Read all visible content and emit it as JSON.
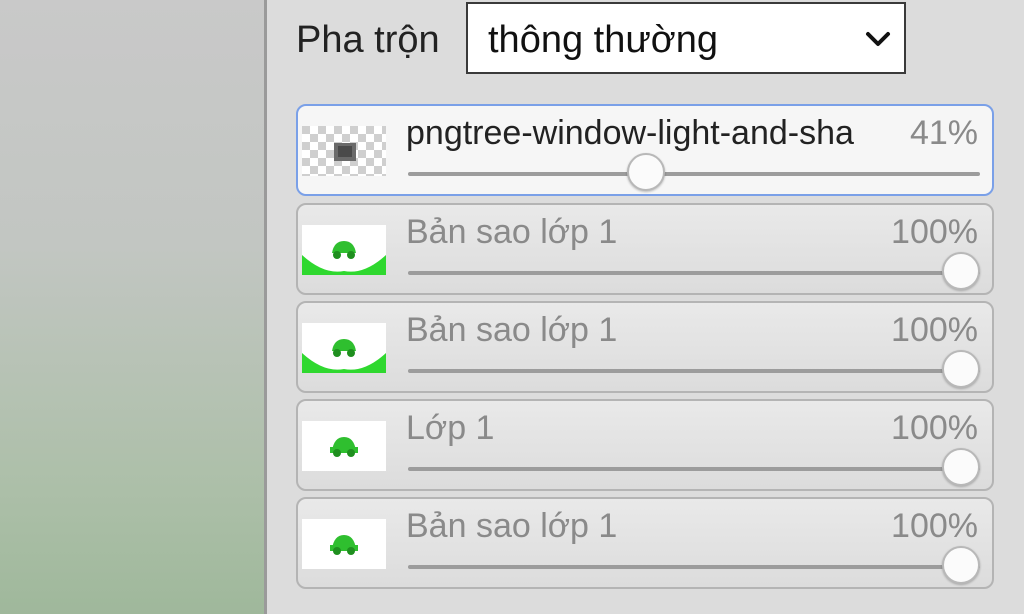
{
  "blend": {
    "label": "Pha trộn",
    "value": "thông thường",
    "chevron_icon": "chevron-down-icon"
  },
  "layers": [
    {
      "name": "pngtree-window-light-and-sha",
      "opacity_text": "41%",
      "opacity": 0.41,
      "active": true,
      "thumb_icon": "transparent-layer-thumbnail"
    },
    {
      "name": "Bản sao lớp 1",
      "opacity_text": "100%",
      "opacity": 1.0,
      "active": false,
      "thumb_icon": "green-car-thumbnail"
    },
    {
      "name": "Bản sao lớp 1",
      "opacity_text": "100%",
      "opacity": 1.0,
      "active": false,
      "thumb_icon": "green-car-thumbnail"
    },
    {
      "name": "Lớp 1",
      "opacity_text": "100%",
      "opacity": 1.0,
      "active": false,
      "thumb_icon": "green-car-thumbnail"
    },
    {
      "name": "Bản sao lớp 1",
      "opacity_text": "100%",
      "opacity": 1.0,
      "active": false,
      "thumb_icon": "green-car-thumbnail"
    }
  ],
  "colors": {
    "active_border": "#7aa0e8",
    "thumb_green": "#2fd82f"
  }
}
